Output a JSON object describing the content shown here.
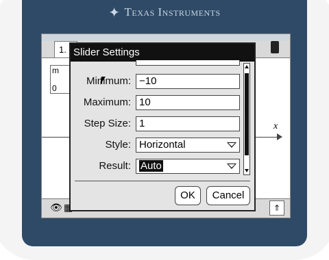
{
  "brand": {
    "name": "Texas Instruments",
    "logo_icon": "ti-logo-icon"
  },
  "screen": {
    "tab_label": "1.",
    "slider_var": "m",
    "slider_zero": "0",
    "x_axis_label": "x"
  },
  "dialog": {
    "title": "Slider Settings",
    "fields": {
      "minimum": {
        "label": "Minimum:",
        "value": "−10"
      },
      "maximum": {
        "label": "Maximum:",
        "value": "10"
      },
      "step": {
        "label": "Step Size:",
        "value": "1"
      },
      "style": {
        "label": "Style:",
        "value": "Horizontal"
      },
      "result": {
        "label": "Result:",
        "value": "Auto"
      }
    },
    "ok_label": "OK",
    "cancel_label": "Cancel"
  },
  "colors": {
    "bezel": "#2f4a66",
    "title_bar": "#111111",
    "dialog_bg": "#e4e4e4"
  }
}
